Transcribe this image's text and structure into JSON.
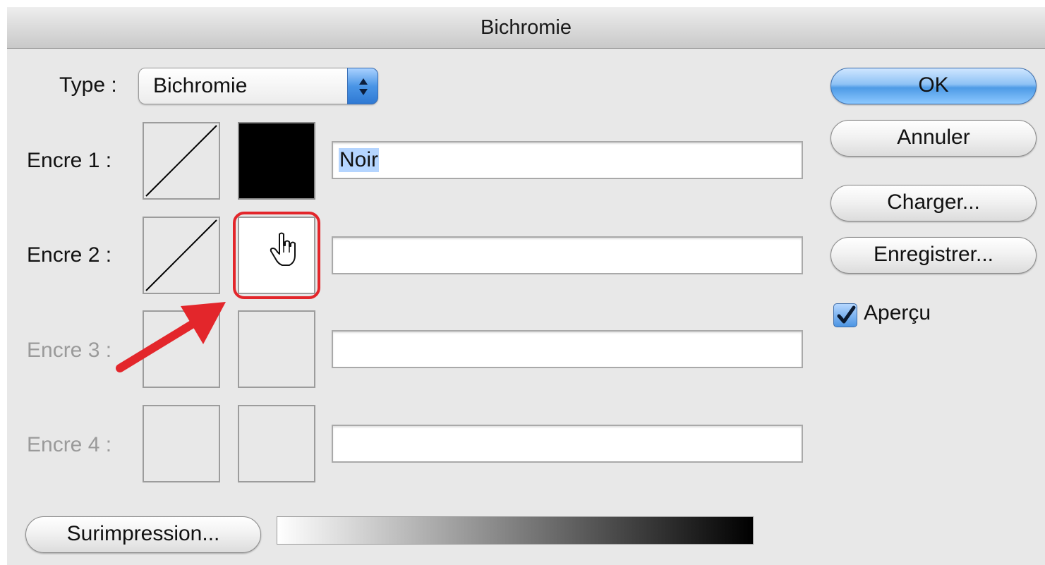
{
  "window": {
    "title": "Bichromie"
  },
  "type_select": {
    "label": "Type :",
    "value": "Bichromie"
  },
  "inks": [
    {
      "label": "Encre 1 :",
      "name": "Noir",
      "color": "#000000",
      "enabled": true
    },
    {
      "label": "Encre 2 :",
      "name": "",
      "color": "#ffffff",
      "enabled": true
    },
    {
      "label": "Encre 3 :",
      "name": "",
      "enabled": false
    },
    {
      "label": "Encre 4 :",
      "name": "",
      "enabled": false
    }
  ],
  "buttons": {
    "ok": "OK",
    "cancel": "Annuler",
    "load": "Charger...",
    "save": "Enregistrer...",
    "overprint": "Surimpression..."
  },
  "preview": {
    "label": "Aperçu",
    "checked": true
  },
  "annotation": {
    "color": "#e3262b"
  },
  "icons": [
    "select-arrows-icon",
    "curve-icon",
    "checkmark-icon",
    "red-arrow-icon",
    "hand-cursor-icon"
  ]
}
